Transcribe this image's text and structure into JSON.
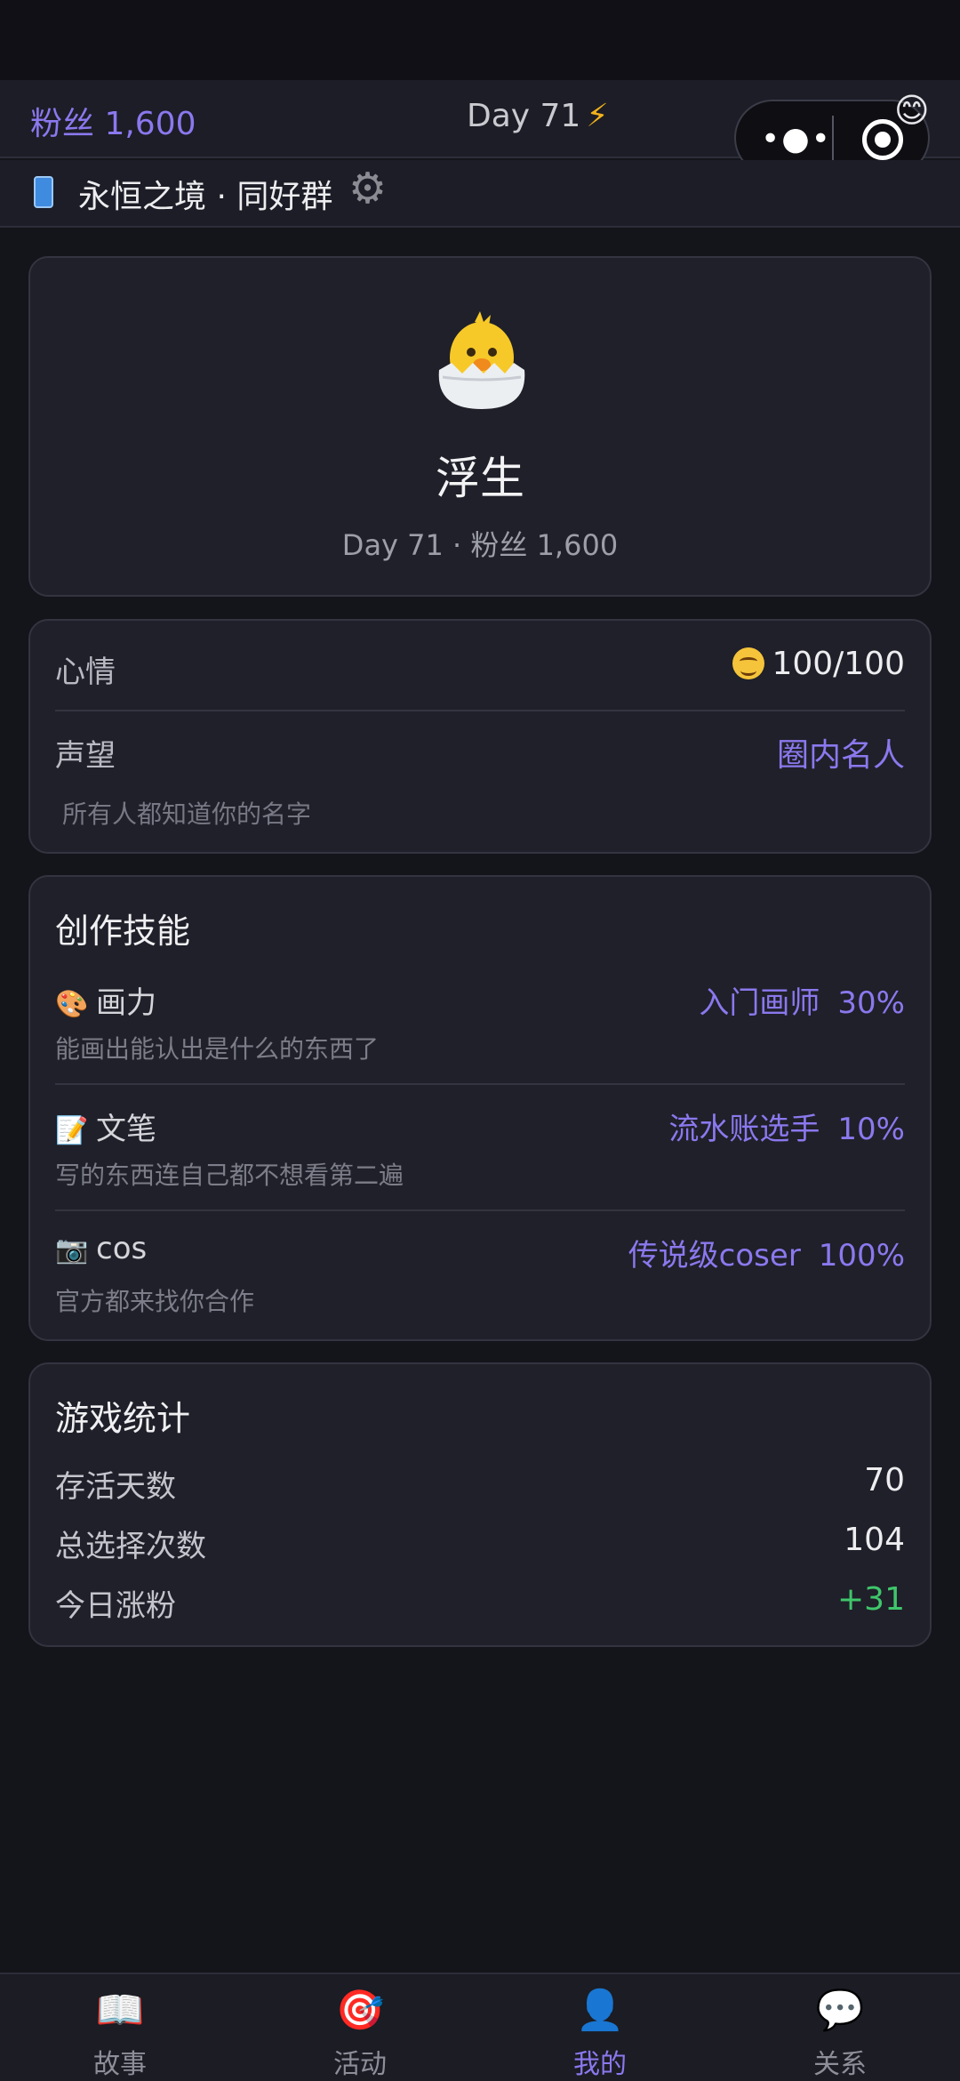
{
  "header": {
    "fans": "粉丝 1,600",
    "day": "Day 71",
    "day_icon": "lightning-icon",
    "group_name": "永恒之境 · 同好群",
    "capsule_emoji": "😊"
  },
  "profile": {
    "avatar": "hatching-chick",
    "name": "浮生",
    "meta": "Day 71 · 粉丝 1,600"
  },
  "status": {
    "mood_label": "心情",
    "mood_value": "100/100",
    "fame_label": "声望",
    "fame_value": "圈内名人",
    "fame_desc": "所有人都知道你的名字"
  },
  "skills": {
    "title": "创作技能",
    "items": [
      {
        "icon": "🎨",
        "name": "画力",
        "rank": "入门画师",
        "percent": "30%",
        "desc": "能画出能认出是什么的东西了"
      },
      {
        "icon": "📝",
        "name": "文笔",
        "rank": "流水账选手",
        "percent": "10%",
        "desc": "写的东西连自己都不想看第二遍"
      },
      {
        "icon": "📷",
        "name": "cos",
        "rank": "传说级coser",
        "percent": "100%",
        "desc": "官方都来找你合作"
      }
    ]
  },
  "stats": {
    "title": "游戏统计",
    "rows": [
      {
        "label": "存活天数",
        "value": "70"
      },
      {
        "label": "总选择次数",
        "value": "104"
      },
      {
        "label": "今日涨粉",
        "value": "+31"
      }
    ]
  },
  "nav": {
    "items": [
      {
        "icon": "📖",
        "label": "故事"
      },
      {
        "icon": "🎯",
        "label": "活动"
      },
      {
        "icon": "👤",
        "label": "我的"
      },
      {
        "icon": "💬",
        "label": "关系"
      }
    ],
    "active_index": 2
  },
  "colors": {
    "accent": "#8b78ee",
    "positive": "#3fc66b",
    "background": "#14141b",
    "card": "#1f2029"
  }
}
